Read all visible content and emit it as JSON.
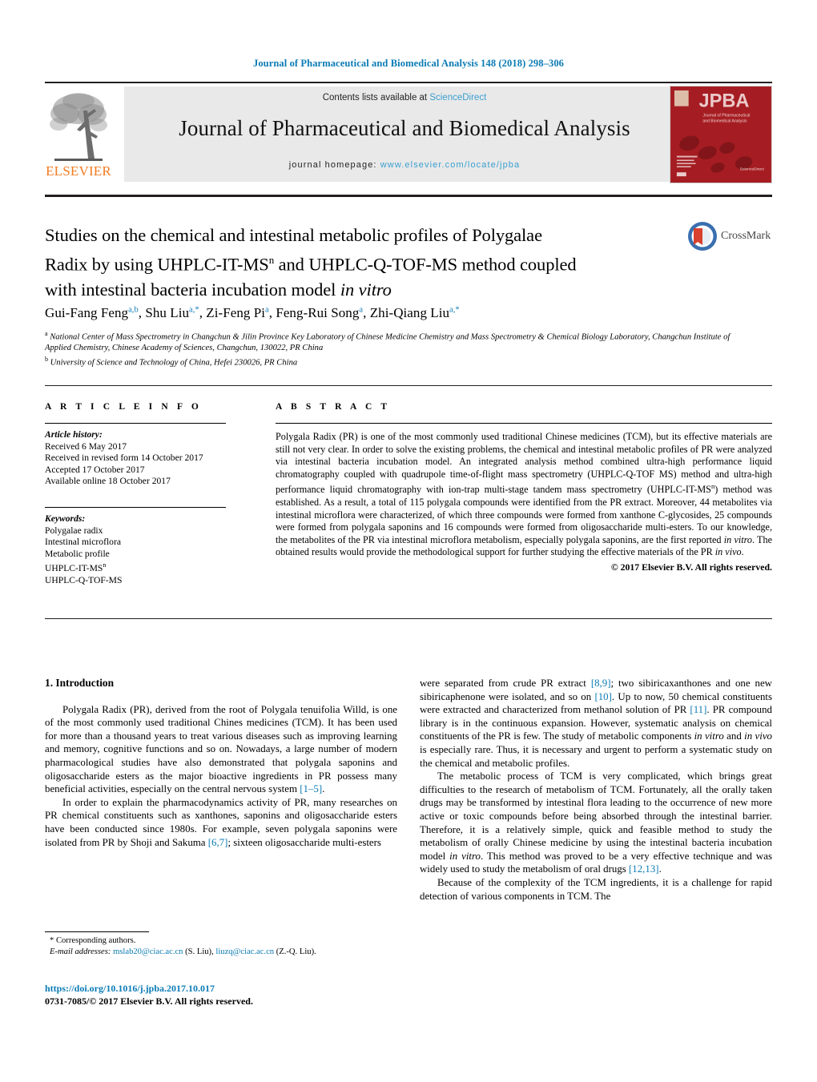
{
  "running_head": "Journal of Pharmaceutical and Biomedical Analysis 148 (2018) 298–306",
  "masthead": {
    "contents_prefix": "Contents lists available at ",
    "sciencedirect": "ScienceDirect",
    "journal_title": "Journal of Pharmaceutical and Biomedical Analysis",
    "homepage_prefix": "journal homepage: ",
    "homepage_url": "www.elsevier.com/locate/jpba",
    "publisher": "ELSEVIER",
    "cover_code": "JPBA",
    "cover_subtitle": "Journal of Pharmaceutical and Biomedical Analysis"
  },
  "crossmark": {
    "label": "CrossMark"
  },
  "article": {
    "title_line1": "Studies on the chemical and intestinal metabolic profiles of Polygalae",
    "title_line2_a": "Radix by using UHPLC-IT-MS",
    "title_line2_sup": "n",
    "title_line2_b": " and UHPLC-Q-TOF-MS method coupled",
    "title_line3_a": "with intestinal bacteria incubation model ",
    "title_line3_italic": "in vitro",
    "authors_html": "Gui-Fang Feng<sup>a,b</sup>, Shu Liu<sup>a,*</sup>, Zi-Feng Pi<sup>a</sup>, Feng-Rui Song<sup>a</sup>, Zhi-Qiang Liu<sup>a,*</sup>",
    "affiliation_a": "National Center of Mass Spectrometry in Changchun & Jilin Province Key Laboratory of Chinese Medicine Chemistry and Mass Spectrometry & Chemical Biology Laboratory, Changchun Institute of Applied Chemistry, Chinese Academy of Sciences, Changchun, 130022, PR China",
    "affiliation_b": "University of Science and Technology of China, Hefei 230026, PR China"
  },
  "article_info": {
    "heading": "A R T I C L E   I N F O",
    "history_label": "Article history:",
    "history": [
      "Received 6 May 2017",
      "Received in revised form 14 October 2017",
      "Accepted 17 October 2017",
      "Available online 18 October 2017"
    ],
    "keywords_label": "Keywords:",
    "keywords": [
      "Polygalae radix",
      "Intestinal microflora",
      "Metabolic profile",
      "UHPLC-IT-MSn",
      "UHPLC-Q-TOF-MS"
    ]
  },
  "abstract": {
    "heading": "A B S T R A C T",
    "text": "Polygala Radix (PR) is one of the most commonly used traditional Chinese medicines (TCM), but its effective materials are still not very clear. In order to solve the existing problems, the chemical and intestinal metabolic profiles of PR were analyzed via intestinal bacteria incubation model. An integrated analysis method combined ultra-high performance liquid chromatography coupled with quadrupole time-of-flight mass spectrometry (UHPLC-Q-TOF MS) method and ultra-high performance liquid chromatography with ion-trap multi-stage tandem mass spectrometry (UHPLC-IT-MSn) method was established. As a result, a total of 115 polygala compounds were identified from the PR extract. Moreover, 44 metabolites via intestinal microflora were characterized, of which three compounds were formed from xanthone C-glycosides, 25 compounds were formed from polygala saponins and 16 compounds were formed from oligosaccharide multi-esters. To our knowledge, the metabolites of the PR via intestinal microflora metabolism, especially polygala saponins, are the first reported in vitro. The obtained results would provide the methodological support for further studying the effective materials of the PR in vivo.",
    "copyright": "© 2017 Elsevier B.V. All rights reserved."
  },
  "introduction": {
    "heading": "1.  Introduction",
    "left_p1": "Polygala Radix (PR), derived from the root of Polygala tenuifolia Willd, is one of the most commonly used traditional Chines medicines (TCM). It has been used for more than a thousand years to treat various diseases such as improving learning and memory, cognitive functions and so on. Nowadays, a large number of modern pharmacological studies have also demonstrated that polygala saponins and oligosaccharide esters as the major bioactive ingredients in PR possess many beneficial activities, especially on the central nervous system [1–5].",
    "left_p2": "In order to explain the pharmacodynamics activity of PR, many researches on PR chemical constituents such as xanthones, saponins and oligosaccharide esters have been conducted since 1980s. For example, seven polygala saponins were isolated from PR by Shoji and Sakuma [6,7]; sixteen oligosaccharide multi-esters",
    "right_p1": "were separated from crude PR extract [8,9]; two sibiricaxanthones and one new sibiricaphenone were isolated, and so on [10]. Up to now, 50 chemical constituents were extracted and characterized from methanol solution of PR [11]. PR compound library is in the continuous expansion. However, systematic analysis on chemical constituents of the PR is few. The study of metabolic components in vitro and in vivo is especially rare. Thus, it is necessary and urgent to perform a systematic study on the chemical and metabolic profiles.",
    "right_p2": "The metabolic process of TCM is very complicated, which brings great difficulties to the research of metabolism of TCM. Fortunately, all the orally taken drugs may be transformed by intestinal flora leading to the occurrence of new more active or toxic compounds before being absorbed through the intestinal barrier. Therefore, it is a relatively simple, quick and feasible method to study the metabolism of orally Chinese medicine by using the intestinal bacteria incubation model in vitro. This method was proved to be a very effective technique and was widely used to study the metabolism of oral drugs [12,13].",
    "right_p3": "Because of the complexity of the TCM ingredients, it is a challenge for rapid detection of various components in TCM. The"
  },
  "footnote": {
    "corresponding": "*  Corresponding authors.",
    "email_label": "E-mail addresses:",
    "email1": "mslab20@ciac.ac.cn",
    "email1_owner": "(S. Liu),",
    "email2": "liuzq@ciac.ac.cn",
    "email2_owner": "(Z.-Q. Liu).",
    "doi": "https://doi.org/10.1016/j.jpba.2017.10.017",
    "issn": "0731-7085/© 2017 Elsevier B.V. All rights reserved."
  },
  "colors": {
    "link_blue": "#0b7bb5",
    "sd_blue": "#3a9fd0",
    "elsevier_orange": "#f47b20",
    "cover_red": "#a51d22",
    "rule_black": "#231f20"
  }
}
